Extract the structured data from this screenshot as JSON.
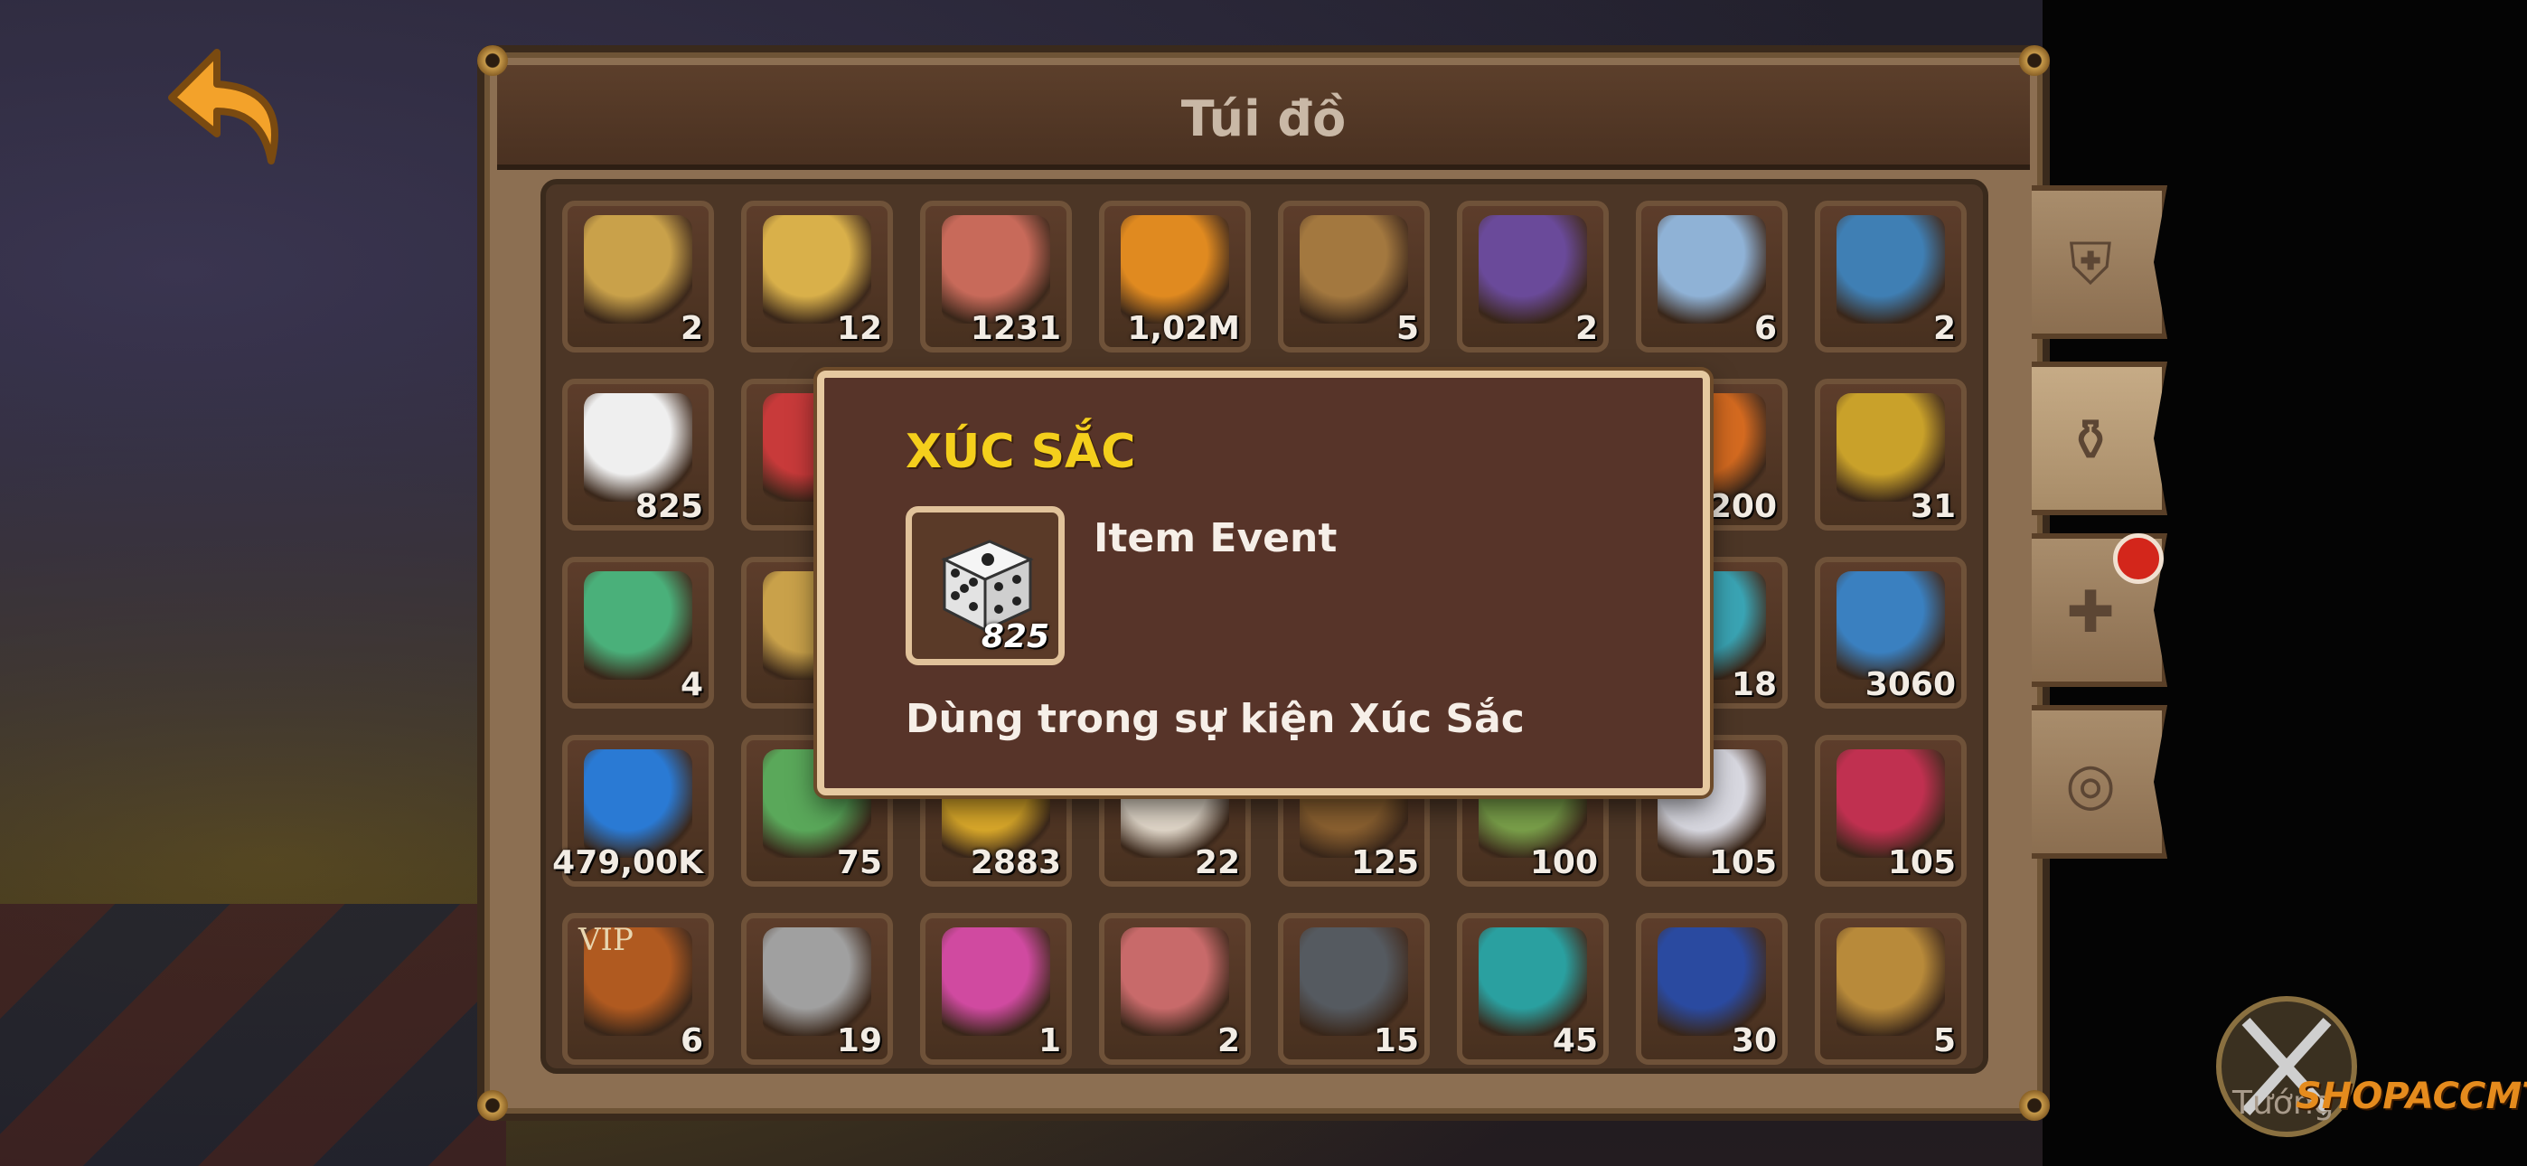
{
  "bag": {
    "title": "Túi đồ",
    "rows": [
      [
        {
          "icon": "gold-book-icon",
          "count": "2"
        },
        {
          "icon": "s-rank-badge-icon",
          "count": "12"
        },
        {
          "icon": "ss-rank-badge-icon",
          "count": "1231"
        },
        {
          "icon": "amber-coin-icon",
          "count": "1,02M"
        },
        {
          "icon": "wood-chest-icon",
          "count": "5"
        },
        {
          "icon": "purple-chest-icon",
          "count": "2"
        },
        {
          "icon": "potion-jar-icon",
          "count": "6"
        },
        {
          "icon": "blue-chest-icon",
          "count": "2"
        }
      ],
      [
        {
          "icon": "dice-icon",
          "count": "825"
        },
        {
          "icon": "red-dice-icon",
          "count": ""
        },
        {
          "icon": "item-icon",
          "count": ""
        },
        {
          "icon": "item-icon",
          "count": ""
        },
        {
          "icon": "item-icon",
          "count": ""
        },
        {
          "icon": "item-icon",
          "count": ""
        },
        {
          "icon": "orange-item-icon",
          "count": "200"
        },
        {
          "icon": "golden-orb-icon",
          "count": "31"
        }
      ],
      [
        {
          "icon": "green-potion-icon",
          "count": "4"
        },
        {
          "icon": "gold-ring-icon",
          "count": ""
        },
        {
          "icon": "item-icon",
          "count": ""
        },
        {
          "icon": "item-icon",
          "count": ""
        },
        {
          "icon": "item-icon",
          "count": ""
        },
        {
          "icon": "item-icon",
          "count": ""
        },
        {
          "icon": "teal-item-icon",
          "count": "18"
        },
        {
          "icon": "portrait-frame-icon",
          "count": "3060"
        }
      ],
      [
        {
          "icon": "blue-gem-icon",
          "count": "479,00K"
        },
        {
          "icon": "island-icon",
          "count": "75"
        },
        {
          "icon": "gold-coin-icon",
          "count": "2883"
        },
        {
          "icon": "mushroom-icon",
          "count": "22"
        },
        {
          "icon": "wood-crate-icon",
          "count": "125"
        },
        {
          "icon": "green-item-icon",
          "count": "100"
        },
        {
          "icon": "white-hat-icon",
          "count": "105"
        },
        {
          "icon": "bead-necklace-icon",
          "count": "105"
        }
      ],
      [
        {
          "icon": "vip-ticket-icon",
          "count": "6"
        },
        {
          "icon": "tombstone-icon",
          "count": "19"
        },
        {
          "icon": "pirate-hat-icon",
          "count": "1"
        },
        {
          "icon": "card-pack-icon",
          "count": "2"
        },
        {
          "icon": "cannon-icon",
          "count": "15"
        },
        {
          "icon": "teal-chest-icon",
          "count": "45"
        },
        {
          "icon": "navy-chest-icon",
          "count": "30"
        },
        {
          "icon": "ship-wheel-icon",
          "count": "5"
        }
      ]
    ],
    "vip_label": "VIP"
  },
  "tooltip": {
    "title": "XÚC SẮC",
    "count": "825",
    "type": "Item Event",
    "description": "Dùng trong sự kiện Xúc Sắc"
  },
  "side_tabs": [
    {
      "icon": "armor-icon"
    },
    {
      "icon": "potion-bag-icon",
      "active": true
    },
    {
      "icon": "puzzle-piece-icon",
      "notification": true
    },
    {
      "icon": "ring-icon"
    }
  ],
  "footer": {
    "tab_label": "Tướng",
    "watermark": "SHOPACCMT.COM"
  },
  "colors": {
    "tooltip_title": "#f4cf1c",
    "panel": "#8c6f52",
    "notification": "#d3261b"
  }
}
